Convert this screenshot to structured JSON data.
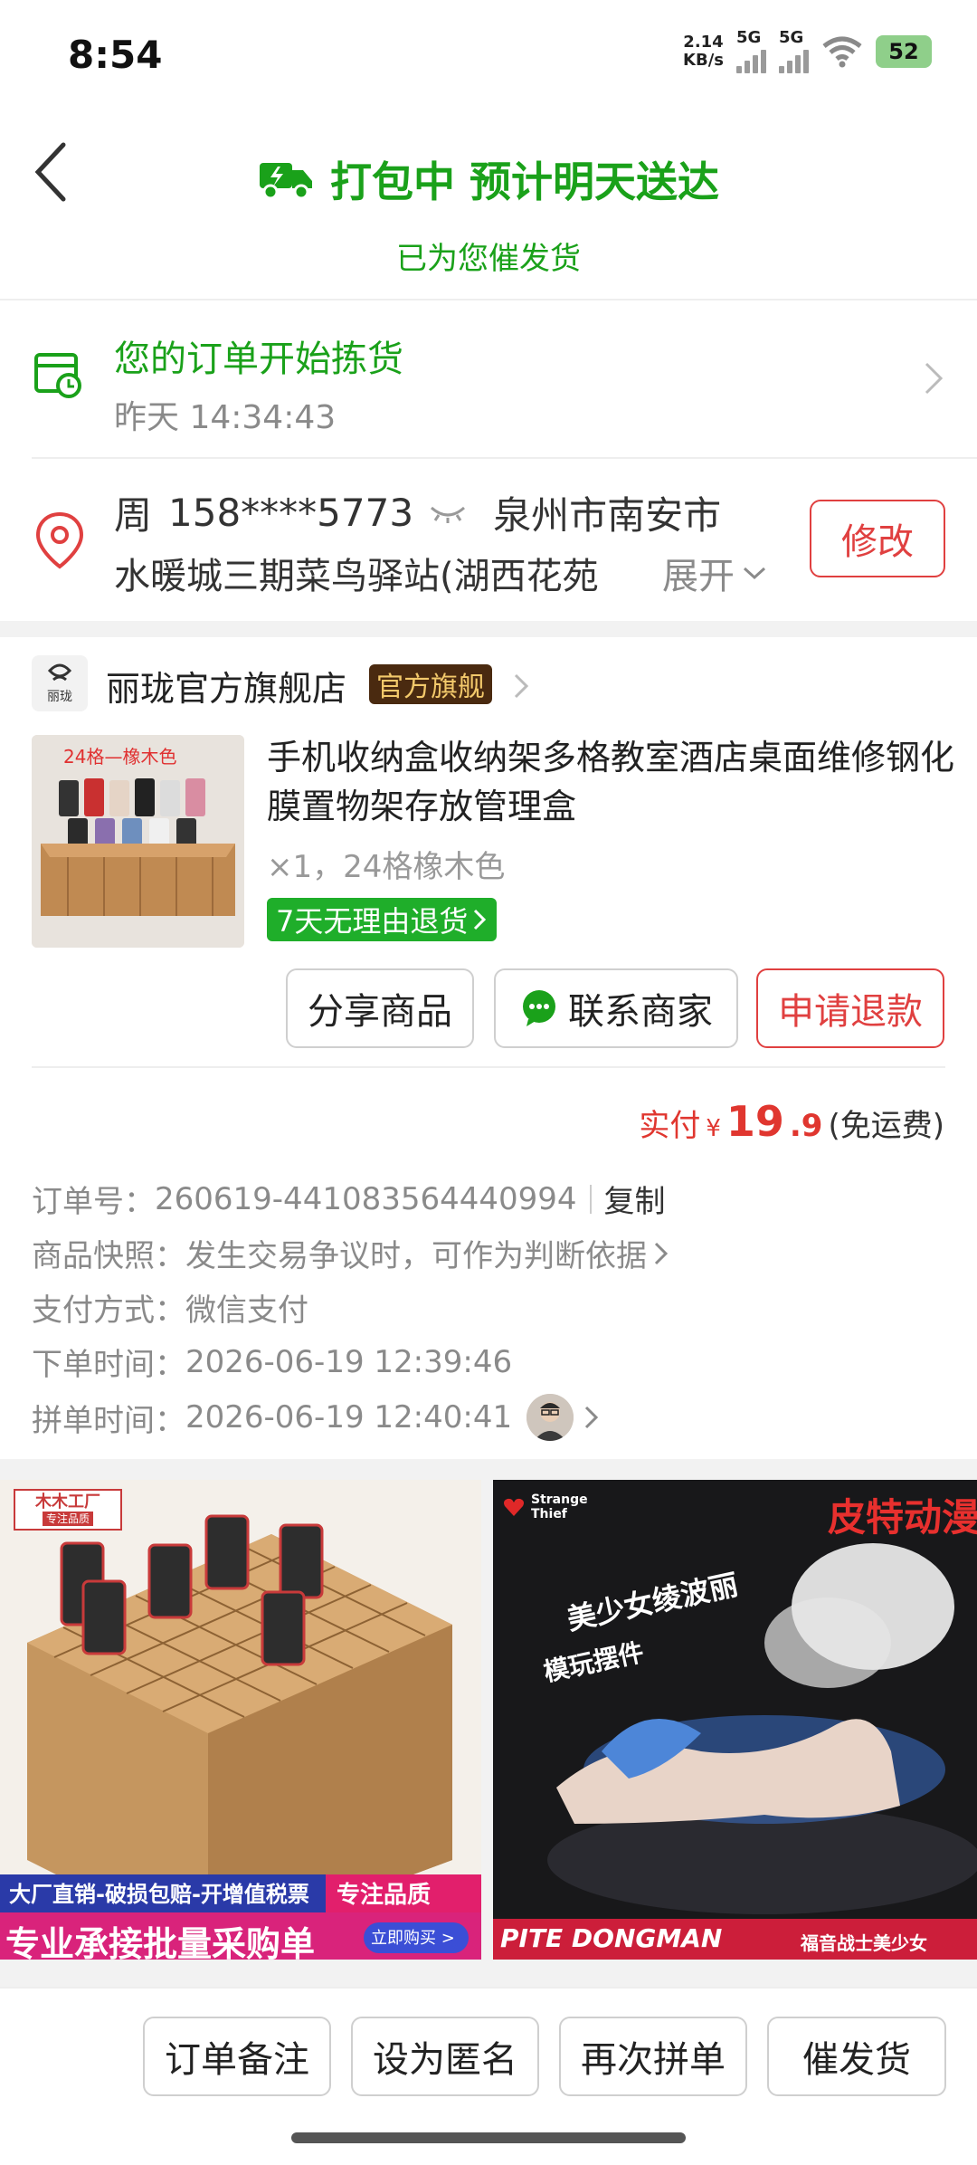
{
  "status_bar": {
    "time": "8:54",
    "speed": "2.14",
    "speed_unit": "KB/s",
    "net1": "5G",
    "net2": "5G",
    "battery": "52"
  },
  "header": {
    "title": "打包中 预计明天送达",
    "subtitle": "已为您催发货",
    "accent": "#1aa11a"
  },
  "order_status": {
    "title": "您的订单开始拣货",
    "time": "昨天 14:34:43"
  },
  "address": {
    "name": "周",
    "phone": "158****5773",
    "city": "泉州市南安市",
    "detail": "水暖城三期菜鸟驿站(湖西花苑",
    "expand": "展开",
    "edit_label": "修改"
  },
  "shop": {
    "logo_text": "丽珑",
    "name": "丽珑官方旗舰店",
    "badge": "官方旗舰"
  },
  "product": {
    "thumb_caption": "24格—橡木色",
    "title": "手机收纳盒收纳架多格教室酒店桌面维修钢化膜置物架存放管理盒",
    "spec": "×1，24格橡木色",
    "return_tag": "7天无理由退货",
    "share_label": "分享商品",
    "contact_label": "联系商家",
    "refund_label": "申请退款"
  },
  "payment": {
    "label": "实付",
    "currency": "¥",
    "amount_int": "19",
    "amount_dec": ".9",
    "shipping": "(免运费)"
  },
  "order_info": {
    "order_no_label": "订单号：",
    "order_no": "260619-441083564440994",
    "copy_label": "复制",
    "snapshot_label": "商品快照：",
    "snapshot_value": "发生交易争议时，可作为判断依据",
    "pay_method_label": "支付方式：",
    "pay_method": "微信支付",
    "order_time_label": "下单时间：",
    "order_time": "2026-06-19 12:39:46",
    "group_time_label": "拼单时间：",
    "group_time": "2026-06-19 12:40:41"
  },
  "feed": {
    "card1": {
      "brand": "木木工厂",
      "brand_sub": "专注品质",
      "banner_top": "大厂直销-破损包赔-开增值税票",
      "banner_top_right": "专注品质",
      "banner_main": "专业承接批量采购单",
      "banner_btn": "立即购买 >"
    },
    "card2": {
      "brand": "皮特动漫",
      "tag_en": "Strange Thief",
      "title1": "美少女绫波丽",
      "title2": "模玩摆件",
      "footer_en": "PITE DONGMAN",
      "footer_cn": "福音战士美少女"
    }
  },
  "bottom_bar": {
    "note": "订单备注",
    "anonymous": "设为匿名",
    "regroup": "再次拼单",
    "urge": "催发货"
  }
}
